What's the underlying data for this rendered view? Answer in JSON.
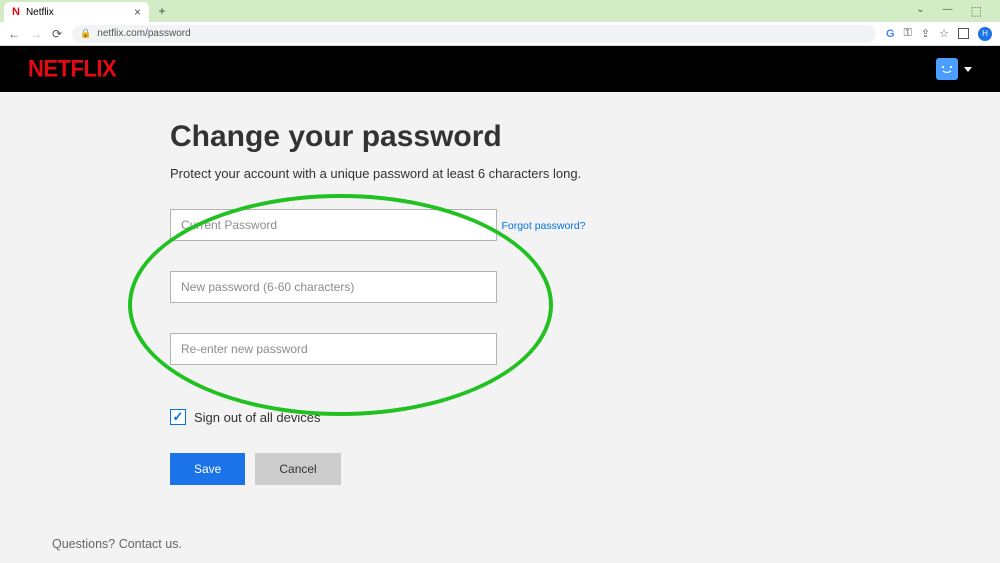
{
  "browser": {
    "tab_title": "Netflix",
    "url": "netflix.com/password"
  },
  "header": {
    "logo_text": "NETFLIX"
  },
  "page": {
    "title": "Change your password",
    "subtitle": "Protect your account with a unique password at least 6 characters long.",
    "current_password_placeholder": "Current Password",
    "forgot_link": "Forgot password?",
    "new_password_placeholder": "New password (6-60 characters)",
    "reenter_placeholder": "Re-enter new password",
    "signout_label": "Sign out of all devices",
    "save_label": "Save",
    "cancel_label": "Cancel"
  },
  "footer": {
    "questions": "Questions? Contact us."
  }
}
